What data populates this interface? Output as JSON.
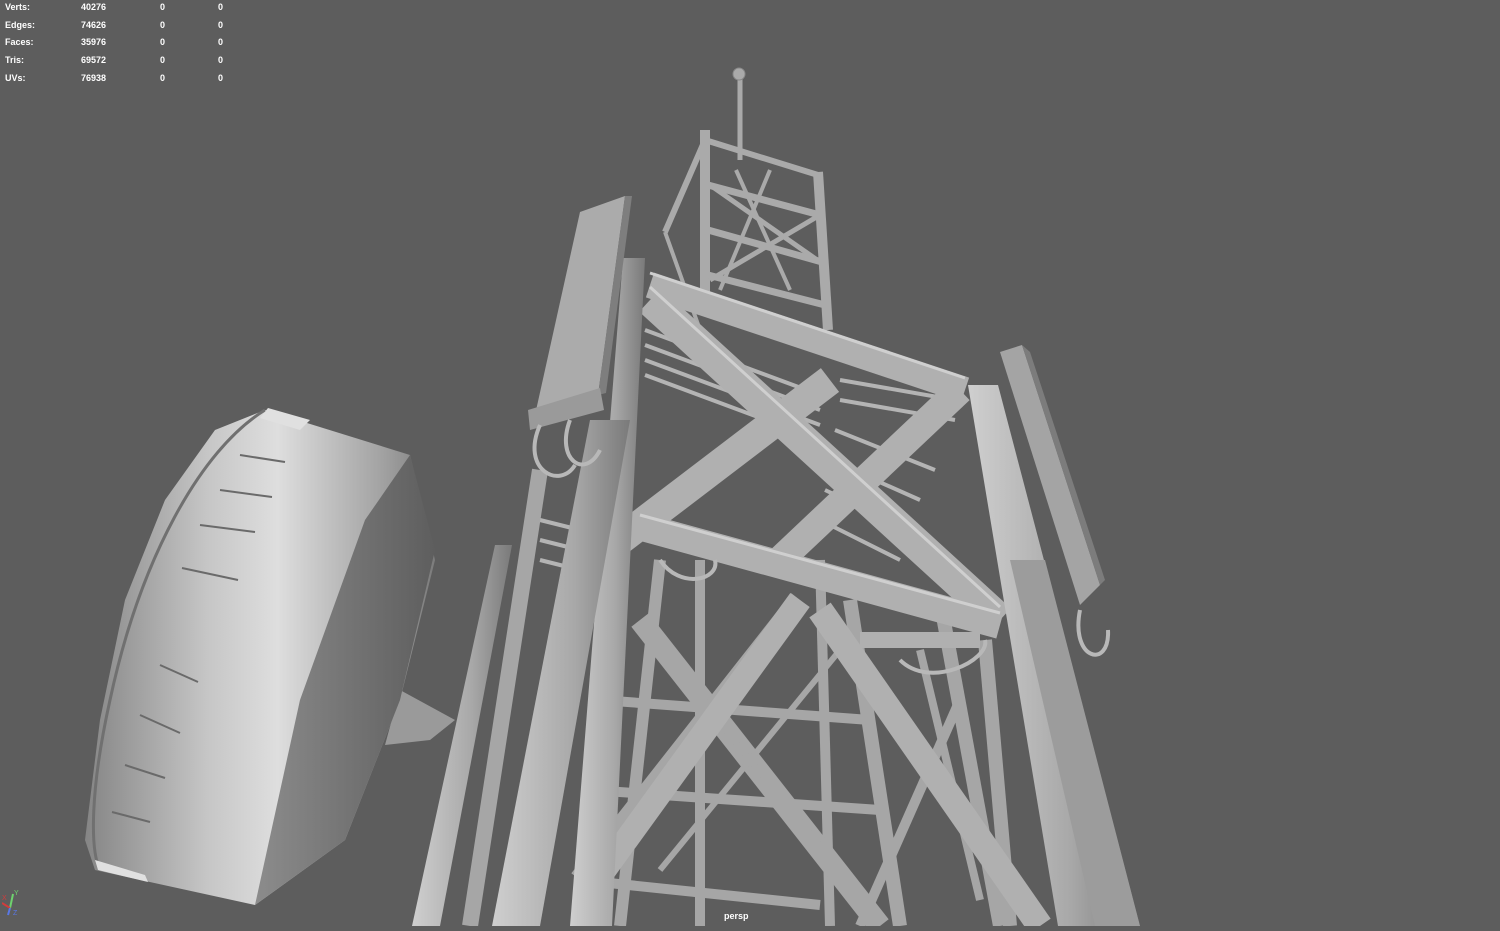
{
  "hud": {
    "rows": [
      {
        "label": "Verts:",
        "v1": "40276",
        "v2": "0",
        "v3": "0"
      },
      {
        "label": "Edges:",
        "v1": "74626",
        "v2": "0",
        "v3": "0"
      },
      {
        "label": "Faces:",
        "v1": "35976",
        "v2": "0",
        "v3": "0"
      },
      {
        "label": "Tris:",
        "v1": "69572",
        "v2": "0",
        "v3": "0"
      },
      {
        "label": "UVs:",
        "v1": "76938",
        "v2": "0",
        "v3": "0"
      }
    ]
  },
  "viewport": {
    "camera_label": "persp",
    "background_color": "#5d5d5d",
    "model_color": "#a8a8a8",
    "model_name_icon": "telecom-tower-model"
  },
  "axis_gizmo": {
    "x_label": "X",
    "y_label": "Y",
    "z_label": "Z",
    "x_color": "#d23c3c",
    "y_color": "#6ed26e",
    "z_color": "#5a78e6"
  }
}
